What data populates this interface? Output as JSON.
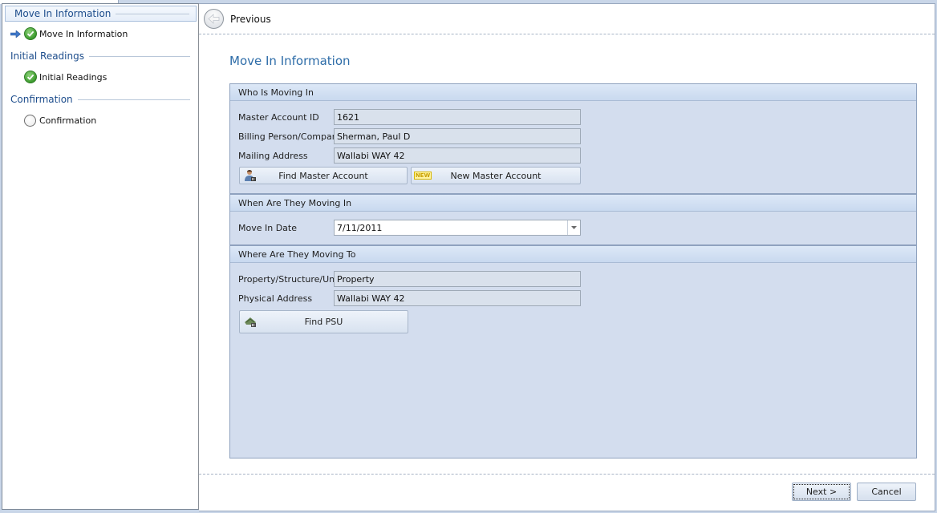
{
  "sidebar": {
    "groups": [
      {
        "label": "Move In Information",
        "selected": true,
        "steps": [
          {
            "label": "Move In Information",
            "status": "complete",
            "current": true
          }
        ]
      },
      {
        "label": "Initial Readings",
        "selected": false,
        "steps": [
          {
            "label": "Initial Readings",
            "status": "complete",
            "current": false
          }
        ]
      },
      {
        "label": "Confirmation",
        "selected": false,
        "steps": [
          {
            "label": "Confirmation",
            "status": "pending",
            "current": false
          }
        ]
      }
    ]
  },
  "nav": {
    "previous_label": "Previous"
  },
  "page": {
    "title": "Move In Information"
  },
  "who": {
    "header": "Who Is Moving In",
    "master_account_id": {
      "label": "Master Account ID",
      "value": "1621"
    },
    "billing": {
      "label": "Billing Person/Company",
      "value": "Sherman, Paul D"
    },
    "mailing": {
      "label": "Mailing Address",
      "value": "Wallabi WAY 42"
    },
    "find_master_label": "Find Master Account",
    "new_master_label": "New Master Account",
    "new_badge": "NEW"
  },
  "when": {
    "header": "When Are They Moving In",
    "move_in_date": {
      "label": "Move In Date",
      "value": "7/11/2011"
    }
  },
  "where": {
    "header": "Where Are They Moving To",
    "psu": {
      "label": "Property/Structure/Unit",
      "value": "Property"
    },
    "physical": {
      "label": "Physical Address",
      "value": "Wallabi WAY 42"
    },
    "find_psu_label": "Find PSU"
  },
  "footer": {
    "next_label": "Next >",
    "cancel_label": "Cancel"
  },
  "colors": {
    "accent": "#2d6ca8",
    "group_header": "#1d4d8c",
    "panel_bg": "#d3ddee",
    "complete": "#3c9b2e"
  }
}
